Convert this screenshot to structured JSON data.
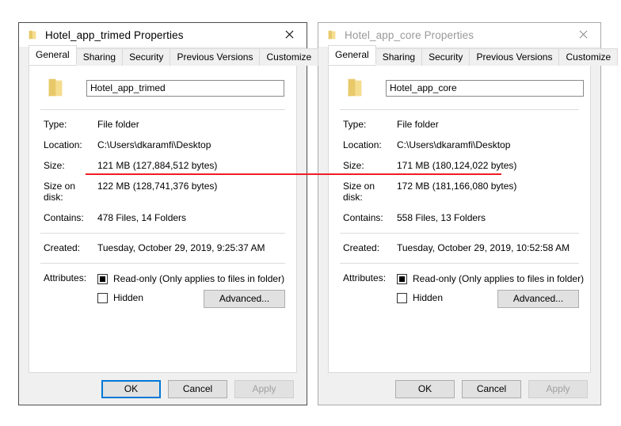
{
  "annotation": {
    "type": "red-underline",
    "color": "#ee1c25",
    "highlights": [
      "Size: 121 MB (127,884,512 bytes)",
      "Size: 171 MB (180,124,022 bytes)"
    ]
  },
  "dialogs": [
    {
      "id": "left",
      "state": "active",
      "title": "Hotel_app_trimed Properties",
      "title_icon": "folder-icon",
      "close_icon": "close-icon",
      "tabs": [
        {
          "label": "General",
          "selected": true
        },
        {
          "label": "Sharing",
          "selected": false
        },
        {
          "label": "Security",
          "selected": false
        },
        {
          "label": "Previous Versions",
          "selected": false
        },
        {
          "label": "Customize",
          "selected": false
        }
      ],
      "header": {
        "icon": "folder-icon",
        "name_value": "Hotel_app_trimed"
      },
      "info": [
        {
          "label": "Type:",
          "value": "File folder"
        },
        {
          "label": "Location:",
          "value": "C:\\Users\\dkaramfi\\Desktop"
        },
        {
          "label": "Size:",
          "value": "121 MB (127,884,512 bytes)"
        },
        {
          "label": "Size on disk:",
          "value": "122 MB (128,741,376 bytes)"
        },
        {
          "label": "Contains:",
          "value": "478 Files, 14 Folders"
        }
      ],
      "created": {
        "label": "Created:",
        "value": "Tuesday, October 29, 2019, 9:25:37 AM"
      },
      "attributes": {
        "label": "Attributes:",
        "readonly": {
          "label": "Read-only (Only applies to files in folder)",
          "state": "filled"
        },
        "hidden": {
          "label": "Hidden",
          "state": "unchecked"
        },
        "advanced_label": "Advanced..."
      },
      "footer": {
        "ok": {
          "label": "OK",
          "default": true,
          "disabled": false
        },
        "cancel": {
          "label": "Cancel",
          "default": false,
          "disabled": false
        },
        "apply": {
          "label": "Apply",
          "default": false,
          "disabled": true
        }
      }
    },
    {
      "id": "right",
      "state": "inactive",
      "title": "Hotel_app_core Properties",
      "title_icon": "folder-icon",
      "close_icon": "close-icon",
      "tabs": [
        {
          "label": "General",
          "selected": true
        },
        {
          "label": "Sharing",
          "selected": false
        },
        {
          "label": "Security",
          "selected": false
        },
        {
          "label": "Previous Versions",
          "selected": false
        },
        {
          "label": "Customize",
          "selected": false
        }
      ],
      "header": {
        "icon": "folder-icon",
        "name_value": "Hotel_app_core"
      },
      "info": [
        {
          "label": "Type:",
          "value": "File folder"
        },
        {
          "label": "Location:",
          "value": "C:\\Users\\dkaramfi\\Desktop"
        },
        {
          "label": "Size:",
          "value": "171 MB (180,124,022 bytes)"
        },
        {
          "label": "Size on disk:",
          "value": "172 MB (181,166,080 bytes)"
        },
        {
          "label": "Contains:",
          "value": "558 Files, 13 Folders"
        }
      ],
      "created": {
        "label": "Created:",
        "value": "Tuesday, October 29, 2019, 10:52:58 AM"
      },
      "attributes": {
        "label": "Attributes:",
        "readonly": {
          "label": "Read-only (Only applies to files in folder)",
          "state": "filled"
        },
        "hidden": {
          "label": "Hidden",
          "state": "unchecked"
        },
        "advanced_label": "Advanced..."
      },
      "footer": {
        "ok": {
          "label": "OK",
          "default": false,
          "disabled": false
        },
        "cancel": {
          "label": "Cancel",
          "default": false,
          "disabled": false
        },
        "apply": {
          "label": "Apply",
          "default": false,
          "disabled": true
        }
      }
    }
  ]
}
